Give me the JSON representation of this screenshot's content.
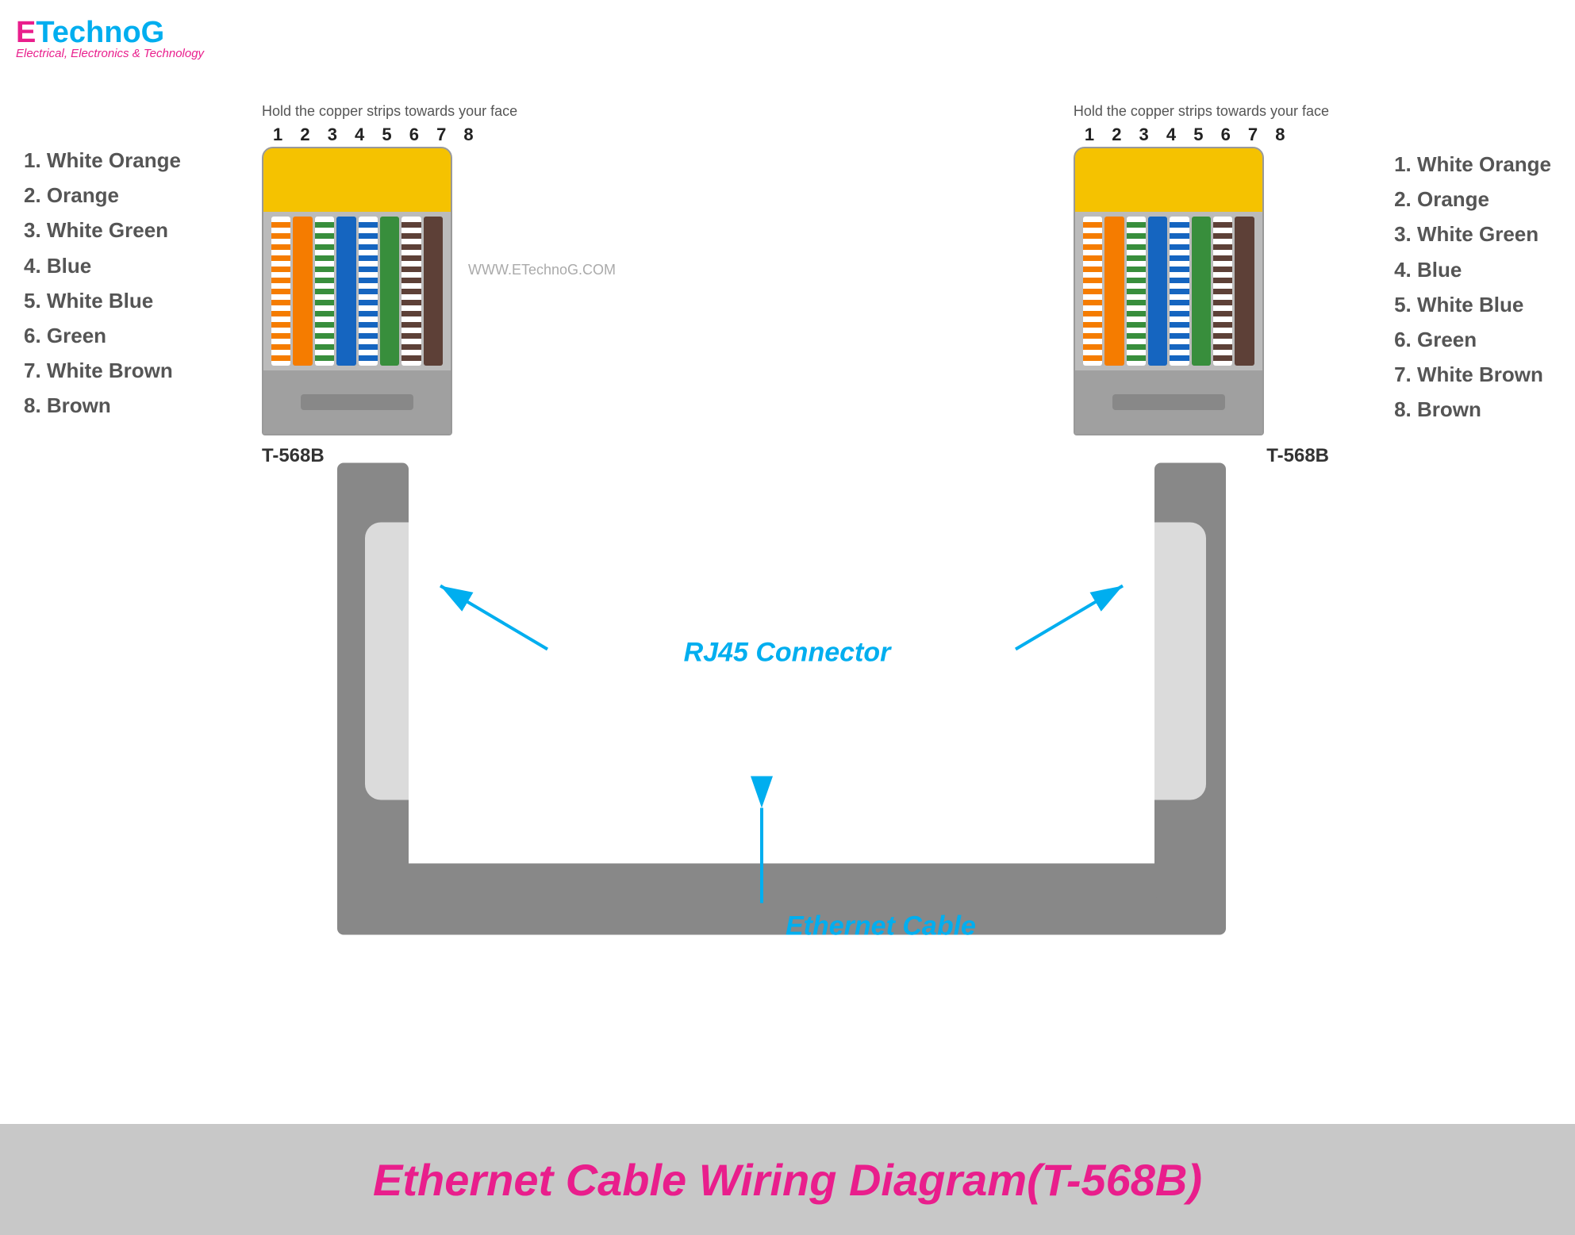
{
  "logo": {
    "e": "E",
    "technog": "TechnoG",
    "subtitle": "Electrical, Electronics & Technology"
  },
  "instruction": "Hold the copper strips towards your face",
  "pin_numbers": "1 2 3 4 5 6 7 8",
  "watermark": "WWW.ETechnoG.COM",
  "left_connector_label": "T-568B",
  "right_connector_label": "T-568B",
  "rj45_connector_label": "RJ45 Connector",
  "ethernet_cable_label": "Ethernet Cable",
  "wire_list": [
    {
      "num": "1.",
      "name": "White Orange"
    },
    {
      "num": "2.",
      "name": "Orange"
    },
    {
      "num": "3.",
      "name": "White Green"
    },
    {
      "num": "4.",
      "name": "Blue"
    },
    {
      "num": "5.",
      "name": "White Blue"
    },
    {
      "num": "6.",
      "name": "Green"
    },
    {
      "num": "7.",
      "name": "White Brown"
    },
    {
      "num": "8.",
      "name": "Brown"
    }
  ],
  "footer_title": "Ethernet Cable Wiring Diagram(T-568B)",
  "colors": {
    "pink": "#e91e8c",
    "cyan": "#00aeef",
    "blue_arrow": "#00aeef",
    "grey_cable": "#888"
  }
}
